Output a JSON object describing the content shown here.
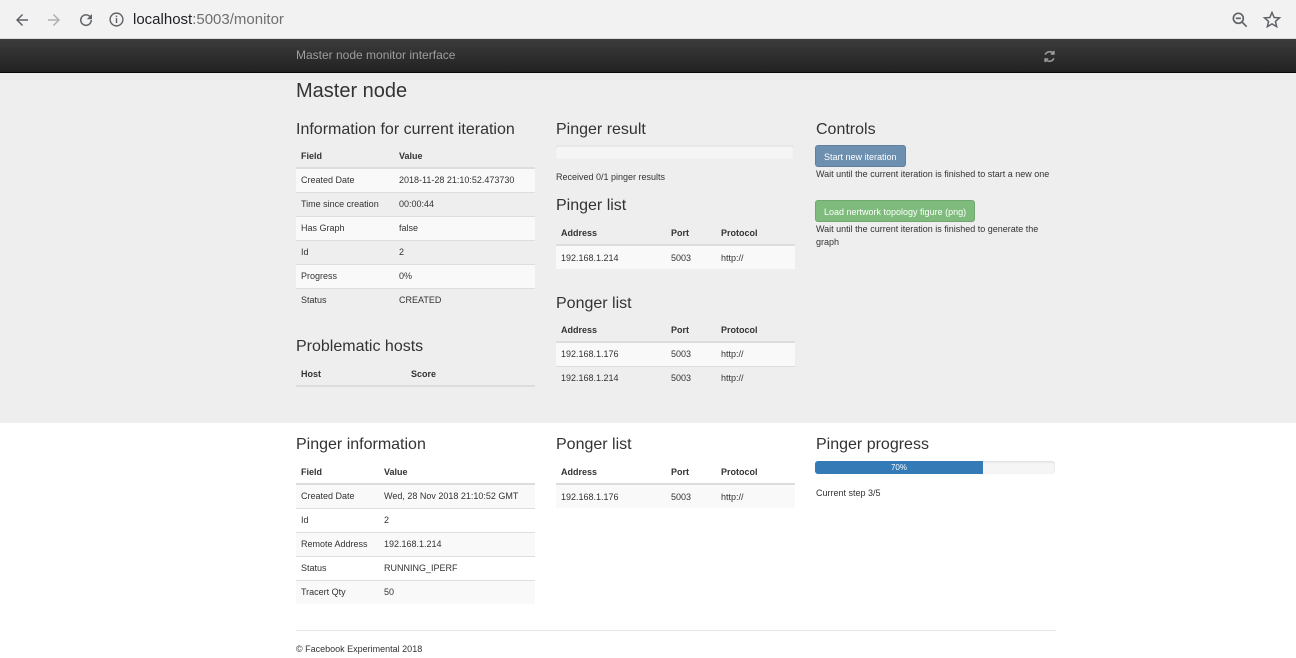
{
  "browser": {
    "url_host": "localhost",
    "url_path": ":5003/monitor"
  },
  "navbar": {
    "brand": "Master node monitor interface"
  },
  "page": {
    "title": "Master node"
  },
  "iteration_info": {
    "title": "Information for current iteration",
    "headers": [
      "Field",
      "Value"
    ],
    "rows": [
      [
        "Created Date",
        "2018-11-28 21:10:52.473730"
      ],
      [
        "Time since creation",
        "00:00:44"
      ],
      [
        "Has Graph",
        "false"
      ],
      [
        "Id",
        "2"
      ],
      [
        "Progress",
        "0%"
      ],
      [
        "Status",
        "CREATED"
      ]
    ]
  },
  "problematic_hosts": {
    "title": "Problematic hosts",
    "headers": [
      "Host",
      "Score"
    ]
  },
  "pinger_result": {
    "title": "Pinger result",
    "progress_fraction": 0,
    "status_text": "Received 0/1 pinger results"
  },
  "pinger_list": {
    "title": "Pinger list",
    "headers": [
      "Address",
      "Port",
      "Protocol"
    ],
    "rows": [
      [
        "192.168.1.214",
        "5003",
        "http://"
      ]
    ]
  },
  "ponger_list": {
    "title": "Ponger list",
    "headers": [
      "Address",
      "Port",
      "Protocol"
    ],
    "rows": [
      [
        "192.168.1.176",
        "5003",
        "http://"
      ],
      [
        "192.168.1.214",
        "5003",
        "http://"
      ]
    ]
  },
  "controls": {
    "title": "Controls",
    "start_button": "Start new iteration",
    "start_note": "Wait until the current iteration is finished to start a new one",
    "topology_button": "Load nertwork topology figure (png)",
    "topology_note": "Wait until the current iteration is finished to generate the graph"
  },
  "pinger_info": {
    "title": "Pinger information",
    "headers": [
      "Field",
      "Value"
    ],
    "rows": [
      [
        "Created Date",
        "Wed, 28 Nov 2018 21:10:52 GMT"
      ],
      [
        "Id",
        "2"
      ],
      [
        "Remote Address",
        "192.168.1.214"
      ],
      [
        "Status",
        "RUNNING_IPERF"
      ],
      [
        "Tracert Qty",
        "50"
      ]
    ]
  },
  "ponger_list_2": {
    "title": "Ponger list",
    "headers": [
      "Address",
      "Port",
      "Protocol"
    ],
    "rows": [
      [
        "192.168.1.176",
        "5003",
        "http://"
      ]
    ]
  },
  "pinger_progress": {
    "title": "Pinger progress",
    "percent": 70,
    "percent_label": "70%",
    "step_text": "Current step 3/5"
  },
  "footer": {
    "text": "© Facebook Experimental 2018"
  },
  "colors": {
    "navbar": "#222222",
    "primary": "#337ab7",
    "success": "#5cb85c",
    "band": "#eeeeee"
  }
}
